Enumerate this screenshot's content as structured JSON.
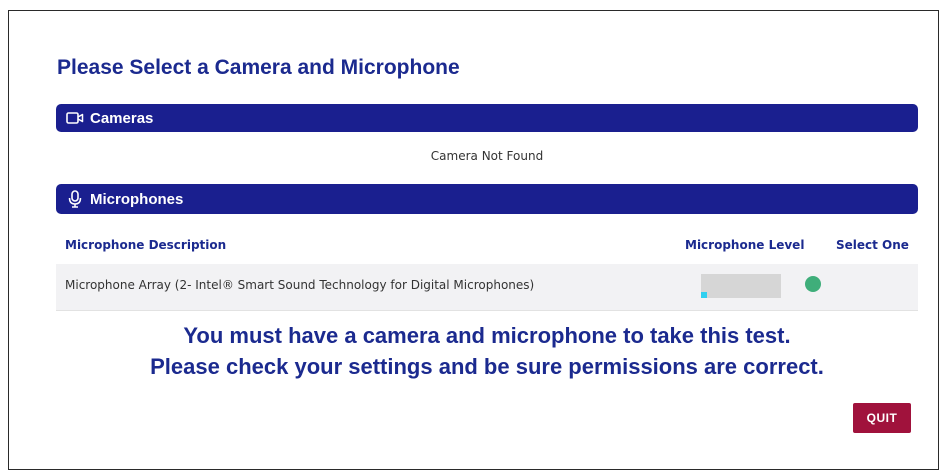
{
  "page": {
    "title": "Please Select a Camera and Microphone"
  },
  "cameras": {
    "header": "Cameras",
    "icon": "video-camera-icon",
    "message": "Camera Not Found"
  },
  "microphones": {
    "header": "Microphones",
    "icon": "microphone-icon",
    "columns": {
      "description": "Microphone Description",
      "level": "Microphone Level",
      "select": "Select One"
    },
    "rows": [
      {
        "description": "Microphone Array (2- Intel® Smart Sound Technology for Digital Microphones)",
        "level_fraction": 0.08,
        "selected": true
      }
    ]
  },
  "warning": {
    "line1": "You must have a camera and microphone to take this test.",
    "line2": "Please check your settings and be sure permissions are correct."
  },
  "actions": {
    "quit_label": "QUIT"
  },
  "colors": {
    "primary": "#1a1f8f",
    "quit": "#a0123c",
    "selected_dot": "#3fae7a",
    "level_fill": "#2fd0f0"
  }
}
